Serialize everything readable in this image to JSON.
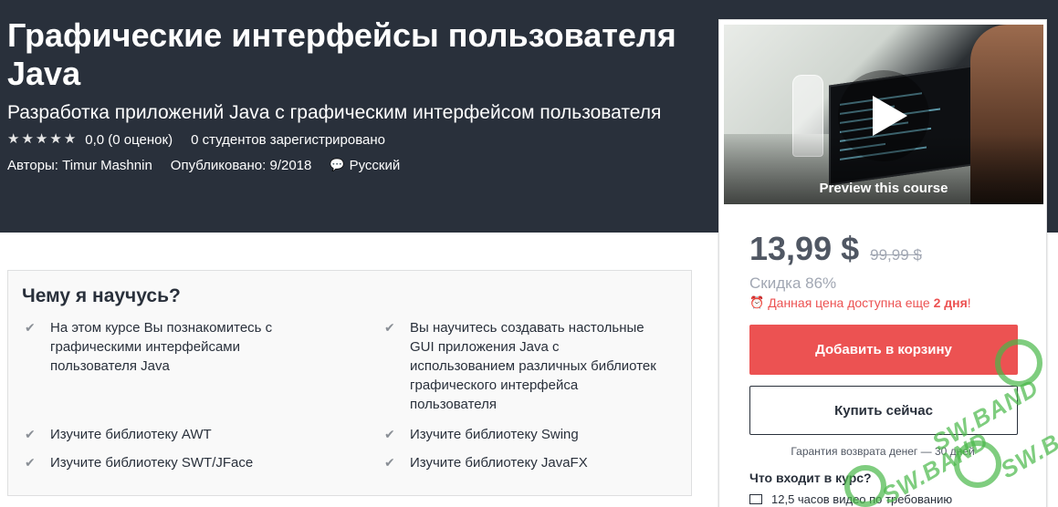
{
  "header": {
    "title": "Графические интерфейсы пользователя Java",
    "subtitle": "Разработка приложений Java с графическим интерфейсом пользователя",
    "rating_value": "0,0 (0 оценок)",
    "students": "0 студентов зарегистрировано",
    "authors": "Авторы: Timur Mashnin",
    "published": "Опубликовано: 9/2018",
    "language": "Русский",
    "stars": [
      "star-icon",
      "star-icon",
      "star-icon",
      "star-icon",
      "star-icon"
    ]
  },
  "preview": {
    "label": "Preview this course"
  },
  "pricing": {
    "price": "13,99 $",
    "old_price": "99,99 $",
    "discount": "Скидка 86%",
    "timer_prefix": "Данная цена доступна еще ",
    "timer_bold": "2 дня",
    "timer_suffix": "!",
    "add_to_cart": "Добавить в корзину",
    "buy_now": "Купить сейчас",
    "guarantee": "Гарантия возврата денег — 30 дней",
    "includes_title": "Что входит в курс?",
    "includes_item": "12,5 часов видео по требованию"
  },
  "learn": {
    "title": "Чему я научусь?",
    "items": [
      [
        "На этом курсе Вы познакомитесь с",
        "графическими интерфейсами",
        "пользователя Java"
      ],
      [
        "Вы научитесь создавать настольные",
        "GUI приложения Java с",
        "использованием различных библиотек",
        "графического интерфейса",
        "пользователя"
      ],
      [
        "Изучите библиотеку AWT"
      ],
      [
        "Изучите библиотеку Swing"
      ],
      [
        "Изучите библиотеку SWT/JFace"
      ],
      [
        "Изучите библиотеку JavaFX"
      ]
    ]
  },
  "watermark": {
    "text": "SW.BAND"
  },
  "colors": {
    "hero_bg": "#29303b",
    "accent_red": "#ec5252",
    "watermark_green": "#49b849"
  }
}
